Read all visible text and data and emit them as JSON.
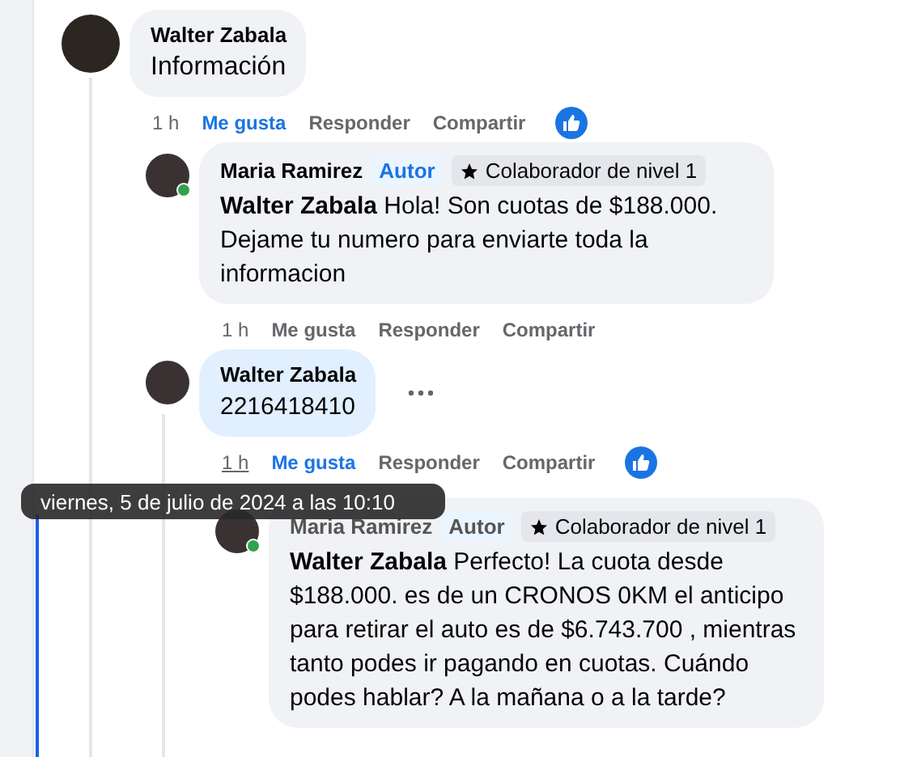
{
  "comments": [
    {
      "author": "Walter Zabala",
      "text": "Información",
      "highlighted": false,
      "more_menu": false,
      "time": {
        "label": "1 h",
        "hovered": false
      },
      "actions": [
        {
          "label": "Me gusta",
          "liked": true
        },
        {
          "label": "Responder",
          "liked": false
        },
        {
          "label": "Compartir",
          "liked": false
        }
      ],
      "reaction_shown": true,
      "children": [
        {
          "author": "Maria Ramirez",
          "online": true,
          "badges": [
            {
              "kind": "author",
              "label": "Autor"
            },
            {
              "kind": "rank",
              "label": "Colaborador de nivel 1"
            }
          ],
          "mention": "Walter Zabala",
          "text": "Hola! Son cuotas de $188.000. Dejame tu numero para enviarte toda la informacion",
          "highlighted": false,
          "more_menu": false,
          "time": {
            "label": "1 h",
            "hovered": false
          },
          "actions": [
            {
              "label": "Me gusta",
              "liked": false
            },
            {
              "label": "Responder",
              "liked": false
            },
            {
              "label": "Compartir",
              "liked": false
            }
          ],
          "reaction_shown": false
        },
        {
          "author": "Walter Zabala",
          "text": "2216418410",
          "highlighted": true,
          "more_menu": true,
          "time": {
            "label": "1 h",
            "hovered": true
          },
          "actions": [
            {
              "label": "Me gusta",
              "liked": true
            },
            {
              "label": "Responder",
              "liked": false
            },
            {
              "label": "Compartir",
              "liked": false
            }
          ],
          "reaction_shown": true,
          "children": [
            {
              "author": "Maria Ramirez",
              "online": true,
              "badges": [
                {
                  "kind": "author",
                  "label": "Autor"
                },
                {
                  "kind": "rank",
                  "label": "Colaborador de nivel 1"
                }
              ],
              "mention": "Walter Zabala",
              "text": "Perfecto! La cuota desde $188.000. es de un CRONOS 0KM el anticipo para retirar el auto es de $6.743.700 , mientras tanto podes ir pagando en cuotas. Cuándo podes hablar? A la mañana o a la tarde?",
              "highlighted": false,
              "more_menu": false
            }
          ]
        }
      ]
    }
  ],
  "tooltip": "viernes, 5 de julio de 2024 a las 10:10"
}
